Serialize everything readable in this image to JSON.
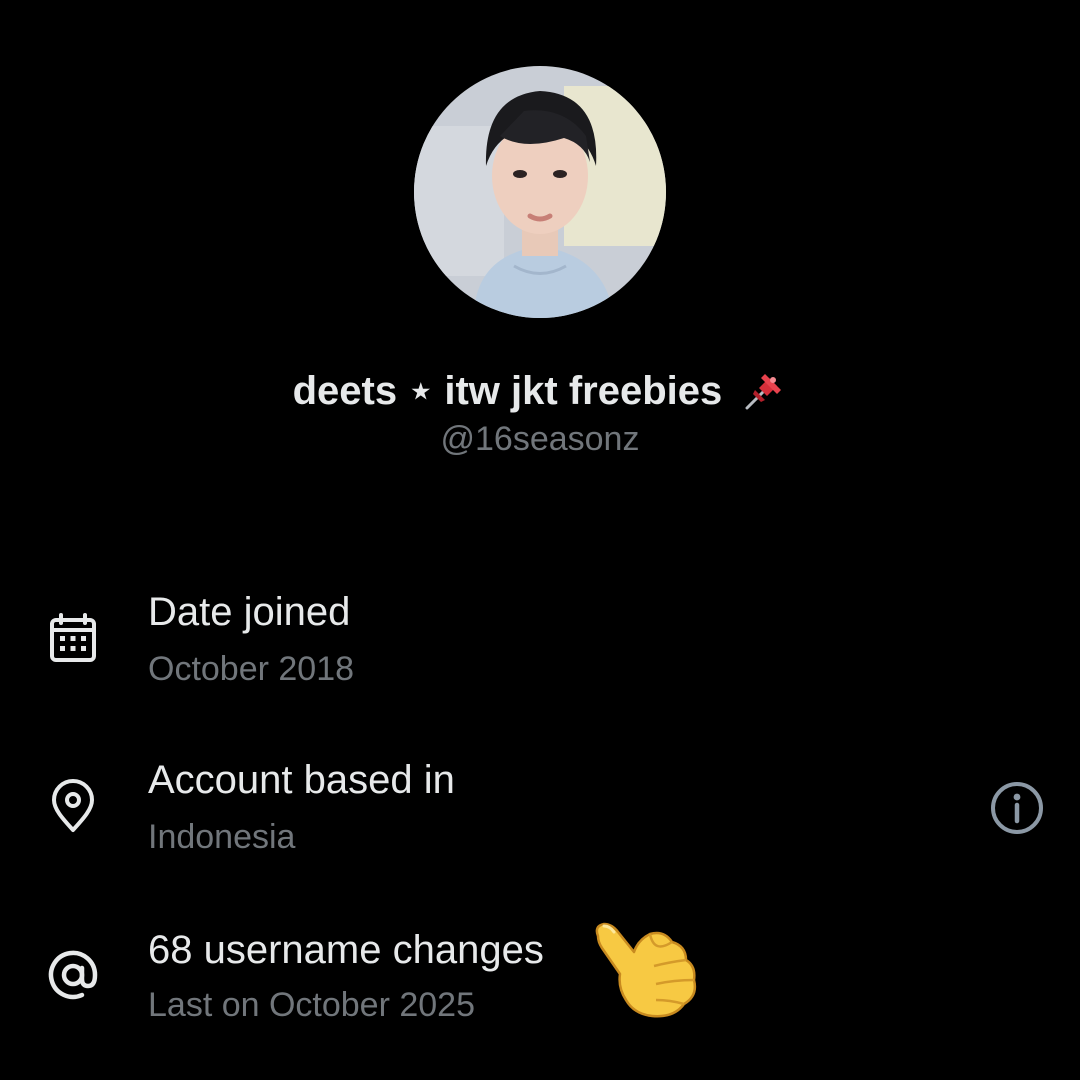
{
  "profile": {
    "display_name": "deets ⋆ itw jkt freebies",
    "handle": "@16seasonz",
    "name_emoji_icon": "pushpin-icon"
  },
  "about": {
    "items": [
      {
        "icon": "calendar-icon",
        "title": "Date joined",
        "subtitle": "October 2018"
      },
      {
        "icon": "location-pin-icon",
        "title": "Account based in",
        "subtitle": "Indonesia",
        "action_icon": "info-icon"
      },
      {
        "icon": "at-sign-icon",
        "title": "68 username changes",
        "subtitle": "Last on October 2025"
      }
    ]
  },
  "overlay": {
    "sticker_icon": "thumbs-pointing-icon"
  },
  "colors": {
    "background": "#000000",
    "primary_text": "#e7e9ea",
    "secondary_text": "#71767b",
    "icon_color": "#e7e9ea",
    "info_icon_color": "#8b98a5"
  }
}
